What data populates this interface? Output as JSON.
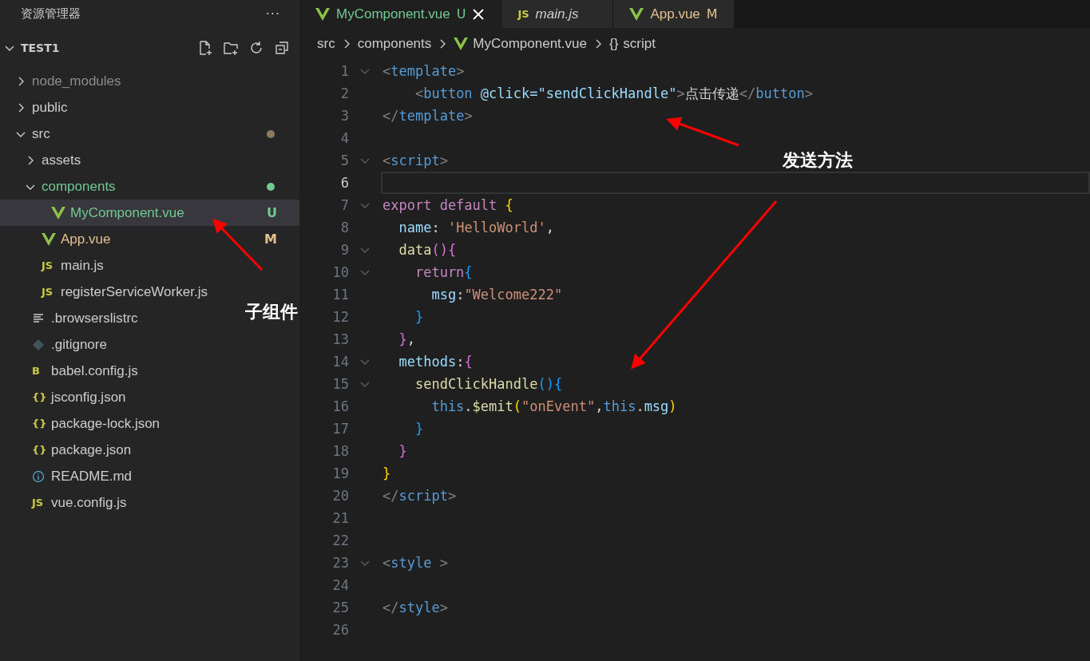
{
  "explorer": {
    "title": "资源管理器",
    "more": "···",
    "root": {
      "label": "TEST1",
      "expanded": true
    }
  },
  "tree": [
    {
      "name": "node_modules",
      "kind": "folder",
      "expanded": false,
      "selected": false,
      "color": "#8c8c8c"
    },
    {
      "name": "public",
      "kind": "folder",
      "expanded": false,
      "selected": false,
      "color": "#cccccc"
    },
    {
      "name": "src",
      "kind": "folder",
      "expanded": true,
      "selected": false,
      "color": "#cccccc",
      "dot": {
        "color": "#8b7a60"
      },
      "children": [
        {
          "name": "assets",
          "kind": "folder",
          "expanded": false,
          "selected": false,
          "color": "#cccccc"
        },
        {
          "name": "components",
          "kind": "folder",
          "expanded": true,
          "selected": false,
          "color": "#73c991",
          "dot": {
            "color": "#73c991"
          },
          "children": [
            {
              "name": "MyComponent.vue",
              "kind": "vue",
              "selected": true,
              "color": "#73c991",
              "badge": "U"
            }
          ]
        },
        {
          "name": "App.vue",
          "kind": "vue",
          "selected": false,
          "color": "#e2c08d",
          "badge": "M"
        },
        {
          "name": "main.js",
          "kind": "glyph",
          "glyph": "JS",
          "selected": false,
          "color": "#cccccc"
        },
        {
          "name": "registerServiceWorker.js",
          "kind": "glyph",
          "glyph": "JS",
          "selected": false,
          "color": "#cccccc"
        }
      ]
    },
    {
      "name": ".browserslistrc",
      "kind": "lines",
      "selected": false,
      "color": "#cccccc"
    },
    {
      "name": ".gitignore",
      "kind": "diamond",
      "selected": false,
      "color": "#cccccc"
    },
    {
      "name": "babel.config.js",
      "kind": "glyph",
      "glyph": "B",
      "selected": false,
      "color": "#cccccc"
    },
    {
      "name": "jsconfig.json",
      "kind": "glyph",
      "glyph": "{}",
      "selected": false,
      "color": "#cccccc"
    },
    {
      "name": "package-lock.json",
      "kind": "glyph",
      "glyph": "{}",
      "selected": false,
      "color": "#cccccc"
    },
    {
      "name": "package.json",
      "kind": "glyph",
      "glyph": "{}",
      "selected": false,
      "color": "#cccccc"
    },
    {
      "name": "README.md",
      "kind": "info",
      "selected": false,
      "color": "#cccccc"
    },
    {
      "name": "vue.config.js",
      "kind": "glyph",
      "glyph": "JS",
      "selected": false,
      "color": "#cccccc"
    }
  ],
  "tabs": [
    {
      "label": "MyComponent.vue",
      "kind": "vue",
      "badge": "U",
      "color": "#73c991",
      "selected": true,
      "preview": false
    },
    {
      "label": "main.js",
      "kind": "glyph",
      "glyph": "JS",
      "color": "#cccccc",
      "selected": false,
      "preview": true
    },
    {
      "label": "App.vue",
      "kind": "vue",
      "badge": "M",
      "color": "#e2c08d",
      "selected": false,
      "preview": false
    }
  ],
  "breadcrumb": [
    {
      "label": "src"
    },
    {
      "label": "components"
    },
    {
      "label": "MyComponent.vue",
      "kind": "vue"
    },
    {
      "label": "script",
      "kind": "glyph",
      "glyph": "{}"
    }
  ],
  "code": [
    {
      "number": "1",
      "foldable": true,
      "current": false,
      "tokens": [
        {
          "kind": "punct",
          "text": "<"
        },
        {
          "kind": "tag",
          "text": "template"
        },
        {
          "kind": "punct",
          "text": ">"
        }
      ]
    },
    {
      "number": "2",
      "foldable": false,
      "current": false,
      "tokens": [
        {
          "kind": "punct",
          "text": "    <"
        },
        {
          "kind": "tag",
          "text": "button "
        },
        {
          "kind": "attr",
          "text": "@click="
        },
        {
          "kind": "attrval",
          "text": "\"sendClickHandle\""
        },
        {
          "kind": "punct",
          "text": ">"
        },
        {
          "kind": "plain",
          "text": "点击传递"
        },
        {
          "kind": "punct",
          "text": "</"
        },
        {
          "kind": "tag",
          "text": "button"
        },
        {
          "kind": "punct",
          "text": ">"
        }
      ]
    },
    {
      "number": "3",
      "foldable": false,
      "current": false,
      "tokens": [
        {
          "kind": "punct",
          "text": "</"
        },
        {
          "kind": "tag",
          "text": "template"
        },
        {
          "kind": "punct",
          "text": ">"
        }
      ]
    },
    {
      "number": "4",
      "foldable": false,
      "current": false
    },
    {
      "number": "5",
      "foldable": true,
      "current": false,
      "tokens": [
        {
          "kind": "punct",
          "text": "<"
        },
        {
          "kind": "tag",
          "text": "script"
        },
        {
          "kind": "punct",
          "text": ">"
        }
      ]
    },
    {
      "number": "6",
      "foldable": false,
      "current": true
    },
    {
      "number": "7",
      "foldable": true,
      "current": false,
      "tokens": [
        {
          "kind": "keyword",
          "text": "export default "
        },
        {
          "kind": "brace1",
          "text": "{"
        }
      ]
    },
    {
      "number": "8",
      "foldable": false,
      "current": false,
      "tokens": [
        {
          "kind": "prop",
          "text": "  name"
        },
        {
          "kind": "plain",
          "text": ": "
        },
        {
          "kind": "string",
          "text": "'HelloWorld'"
        },
        {
          "kind": "plain",
          "text": ","
        }
      ]
    },
    {
      "number": "9",
      "foldable": true,
      "current": false,
      "tokens": [
        {
          "kind": "func",
          "text": "  data"
        },
        {
          "kind": "brace2",
          "text": "(){"
        }
      ]
    },
    {
      "number": "10",
      "foldable": true,
      "current": false,
      "tokens": [
        {
          "kind": "keyword",
          "text": "    return"
        },
        {
          "kind": "brace3",
          "text": "{"
        }
      ]
    },
    {
      "number": "11",
      "foldable": false,
      "current": false,
      "tokens": [
        {
          "kind": "prop",
          "text": "      msg"
        },
        {
          "kind": "plain",
          "text": ":"
        },
        {
          "kind": "string",
          "text": "\"Welcome222\""
        }
      ]
    },
    {
      "number": "12",
      "foldable": false,
      "current": false,
      "tokens": [
        {
          "kind": "brace3",
          "text": "    }"
        }
      ]
    },
    {
      "number": "13",
      "foldable": false,
      "current": false,
      "tokens": [
        {
          "kind": "brace2",
          "text": "  }"
        },
        {
          "kind": "plain",
          "text": ","
        }
      ]
    },
    {
      "number": "14",
      "foldable": true,
      "current": false,
      "tokens": [
        {
          "kind": "prop",
          "text": "  methods"
        },
        {
          "kind": "plain",
          "text": ":"
        },
        {
          "kind": "brace2",
          "text": "{"
        }
      ]
    },
    {
      "number": "15",
      "foldable": true,
      "current": false,
      "tokens": [
        {
          "kind": "func",
          "text": "    sendClickHandle"
        },
        {
          "kind": "brace3",
          "text": "(){"
        }
      ]
    },
    {
      "number": "16",
      "foldable": false,
      "current": false,
      "tokens": [
        {
          "kind": "this",
          "text": "      this"
        },
        {
          "kind": "plain",
          "text": "."
        },
        {
          "kind": "func",
          "text": "$emit"
        },
        {
          "kind": "brace1",
          "text": "("
        },
        {
          "kind": "string",
          "text": "\"onEvent\""
        },
        {
          "kind": "plain",
          "text": ","
        },
        {
          "kind": "this",
          "text": "this"
        },
        {
          "kind": "plain",
          "text": "."
        },
        {
          "kind": "prop",
          "text": "msg"
        },
        {
          "kind": "brace1",
          "text": ")"
        }
      ]
    },
    {
      "number": "17",
      "foldable": false,
      "current": false,
      "tokens": [
        {
          "kind": "brace3",
          "text": "    }"
        }
      ]
    },
    {
      "number": "18",
      "foldable": false,
      "current": false,
      "tokens": [
        {
          "kind": "brace2",
          "text": "  }"
        }
      ]
    },
    {
      "number": "19",
      "foldable": false,
      "current": false,
      "tokens": [
        {
          "kind": "brace1",
          "text": "}"
        }
      ]
    },
    {
      "number": "20",
      "foldable": false,
      "current": false,
      "tokens": [
        {
          "kind": "punct",
          "text": "</"
        },
        {
          "kind": "tag",
          "text": "script"
        },
        {
          "kind": "punct",
          "text": ">"
        }
      ]
    },
    {
      "number": "21",
      "foldable": false,
      "current": false
    },
    {
      "number": "22",
      "foldable": false,
      "current": false
    },
    {
      "number": "23",
      "foldable": true,
      "current": false,
      "tokens": [
        {
          "kind": "punct",
          "text": "<"
        },
        {
          "kind": "tag",
          "text": "style"
        },
        {
          "kind": "punct",
          "text": " >"
        }
      ]
    },
    {
      "number": "24",
      "foldable": false,
      "current": false
    },
    {
      "number": "25",
      "foldable": false,
      "current": false,
      "tokens": [
        {
          "kind": "punct",
          "text": "</"
        },
        {
          "kind": "tag",
          "text": "style"
        },
        {
          "kind": "punct",
          "text": ">"
        }
      ]
    },
    {
      "number": "26",
      "foldable": false,
      "current": false
    }
  ],
  "annotations": [
    {
      "text": "子组件",
      "kind": "child"
    },
    {
      "text": "发送方法",
      "kind": "send"
    }
  ]
}
